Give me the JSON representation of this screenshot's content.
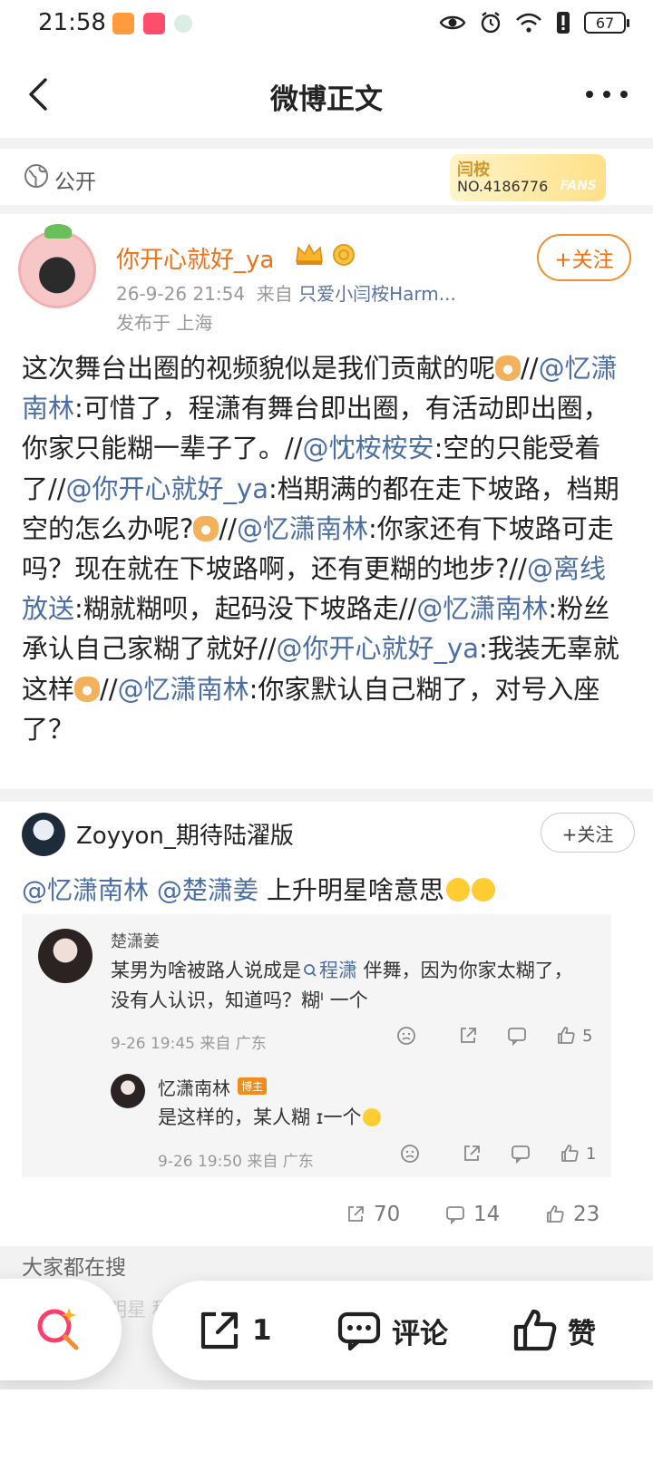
{
  "status_bar": {
    "time": "21:58",
    "battery": "67"
  },
  "header": {
    "title": "微博正文"
  },
  "visibility": {
    "label": "公开"
  },
  "fans_badge": {
    "name": "闫桉",
    "number": "NO.4186776",
    "word": "FANS"
  },
  "post": {
    "author": "你开心就好_ya",
    "time": "26-9-26 21:54",
    "source_prefix": "来自",
    "source": "只爱小闫桉Harm...",
    "location": "发布于 上海",
    "follow_label": "+关注",
    "text_parts": {
      "p1": "这次舞台出圈的视频貌似是我们贡献的呢",
      "p2": "//",
      "m1": "@忆潇南林",
      "p3": ":可惜了，程潇有舞台即出圈，有活动即出圈，你家只能糊一辈子了。//",
      "m2": "@忱桉桉安",
      "p4": ":空的只能受着了//",
      "m3": "@你开心就好_ya",
      "p5": ":档期满的都在走下坡路，档期空的怎么办呢?",
      "p6": "//",
      "m4": "@忆潇南林",
      "p7": ":你家还有下坡路可走吗？现在就在下坡路啊，还有更糊的地步?//",
      "m5": "@离线放送",
      "p8": ":糊就糊呗，起码没下坡路走//",
      "m6": "@忆潇南林",
      "p9": ":粉丝承认自己家糊了就好//",
      "m7": "@你开心就好_ya",
      "p10": ":我装无辜就这样",
      "p11": "//",
      "m8": "@忆潇南林",
      "p12": ":你家默认自己糊了，对号入座了？"
    }
  },
  "repost": {
    "author": "Zoyyon_期待陆濯版",
    "follow_label": "+关注",
    "mention1": "@忆潇南林",
    "mention2": "@楚潇姜",
    "text": " 上升明星啥意思",
    "quoted_comment": {
      "user": "楚潇姜",
      "text_before": "某男为啥被路人说成是",
      "search_term": "程潇",
      "text_after": " 伴舞，因为你家太糊了，没有人认识，知道吗？糊ᴵ  一个",
      "meta": "9-26 19:45 来自 广东",
      "like_count": "5"
    },
    "reply": {
      "user": "忆潇南林",
      "badge": "博主",
      "text": "是这样的，某人糊  ɪ一个",
      "meta": "9-26 19:50 来自 广东",
      "like_count": "1"
    },
    "stats": {
      "reposts": "70",
      "comments": "14",
      "likes": "23"
    }
  },
  "trending": {
    "label": "大家都在搜",
    "items": "升明星         程潇伴舞         程潇代言"
  },
  "bottom_actions": {
    "repost_count": "1",
    "comment_label": "评论",
    "like_label": "赞"
  },
  "colors": {
    "accent_orange": "#f07015",
    "link_blue": "#4b6fa5",
    "host_badge": "#f28b1a"
  }
}
